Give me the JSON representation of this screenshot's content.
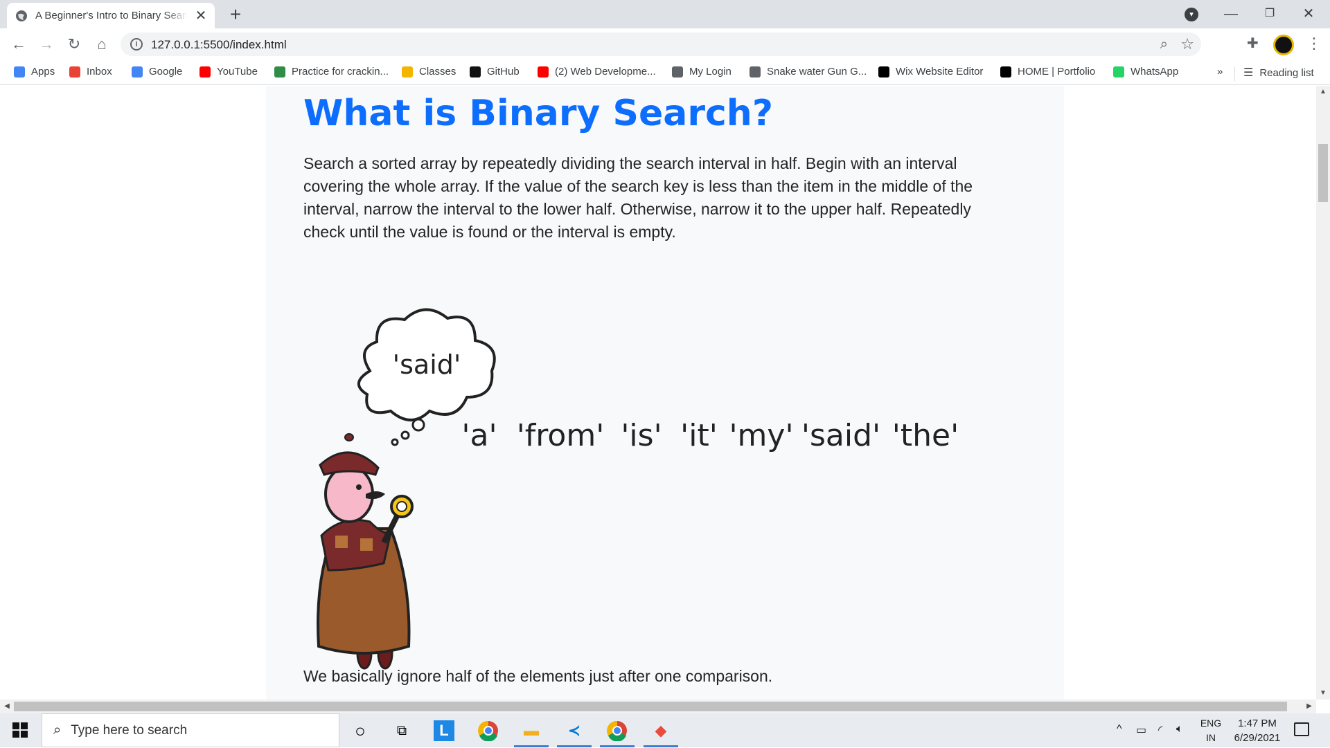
{
  "browser": {
    "tab_title": "A Beginner's Intro to Binary Search",
    "url": "127.0.0.1:5500/index.html",
    "bookmarks": [
      {
        "label": "Apps",
        "icon": "apps-grid-icon",
        "color": "#4285f4"
      },
      {
        "label": "Inbox",
        "icon": "gmail-icon",
        "color": "#ea4335"
      },
      {
        "label": "Google",
        "icon": "google-icon",
        "color": "#4285f4"
      },
      {
        "label": "YouTube",
        "icon": "youtube-icon",
        "color": "#ff0000"
      },
      {
        "label": "Practice for crackin...",
        "icon": "gfg-icon",
        "color": "#2f8d46"
      },
      {
        "label": "Classes",
        "icon": "classroom-icon",
        "color": "#f4b400"
      },
      {
        "label": "GitHub",
        "icon": "github-icon",
        "color": "#111111"
      },
      {
        "label": "(2) Web Developme...",
        "icon": "youtube-icon",
        "color": "#ff0000"
      },
      {
        "label": "My Login",
        "icon": "login-icon",
        "color": "#5f6368"
      },
      {
        "label": "Snake water Gun G...",
        "icon": "globe-icon",
        "color": "#5f6368"
      },
      {
        "label": "Wix Website Editor",
        "icon": "wix-icon",
        "color": "#000000"
      },
      {
        "label": "HOME | Portfolio",
        "icon": "wix-icon",
        "color": "#000000"
      },
      {
        "label": "WhatsApp",
        "icon": "whatsapp-icon",
        "color": "#25d366"
      }
    ],
    "more_label": "»",
    "reading_list": "Reading list"
  },
  "page": {
    "heading": "What is Binary Search?",
    "paragraph": "Search a sorted array by repeatedly dividing the search interval in half. Begin with an interval covering the whole array. If the value of the search key is less than the item in the middle of the interval, narrow the interval to the lower half. Otherwise, narrow it to the upper half. Repeatedly check until the value is found or the interval is empty.",
    "illustration": {
      "thought_word": "'said'",
      "words": [
        "'a'",
        "'from'",
        "'is'",
        "'it'",
        "'my'",
        "'said'",
        "'the'"
      ]
    },
    "paragraph2": "We basically ignore half of the elements just after one comparison."
  },
  "taskbar": {
    "search_placeholder": "Type here to search",
    "lang_top": "ENG",
    "lang_bottom": "IN",
    "time": "1:47 PM",
    "date": "6/29/2021"
  }
}
